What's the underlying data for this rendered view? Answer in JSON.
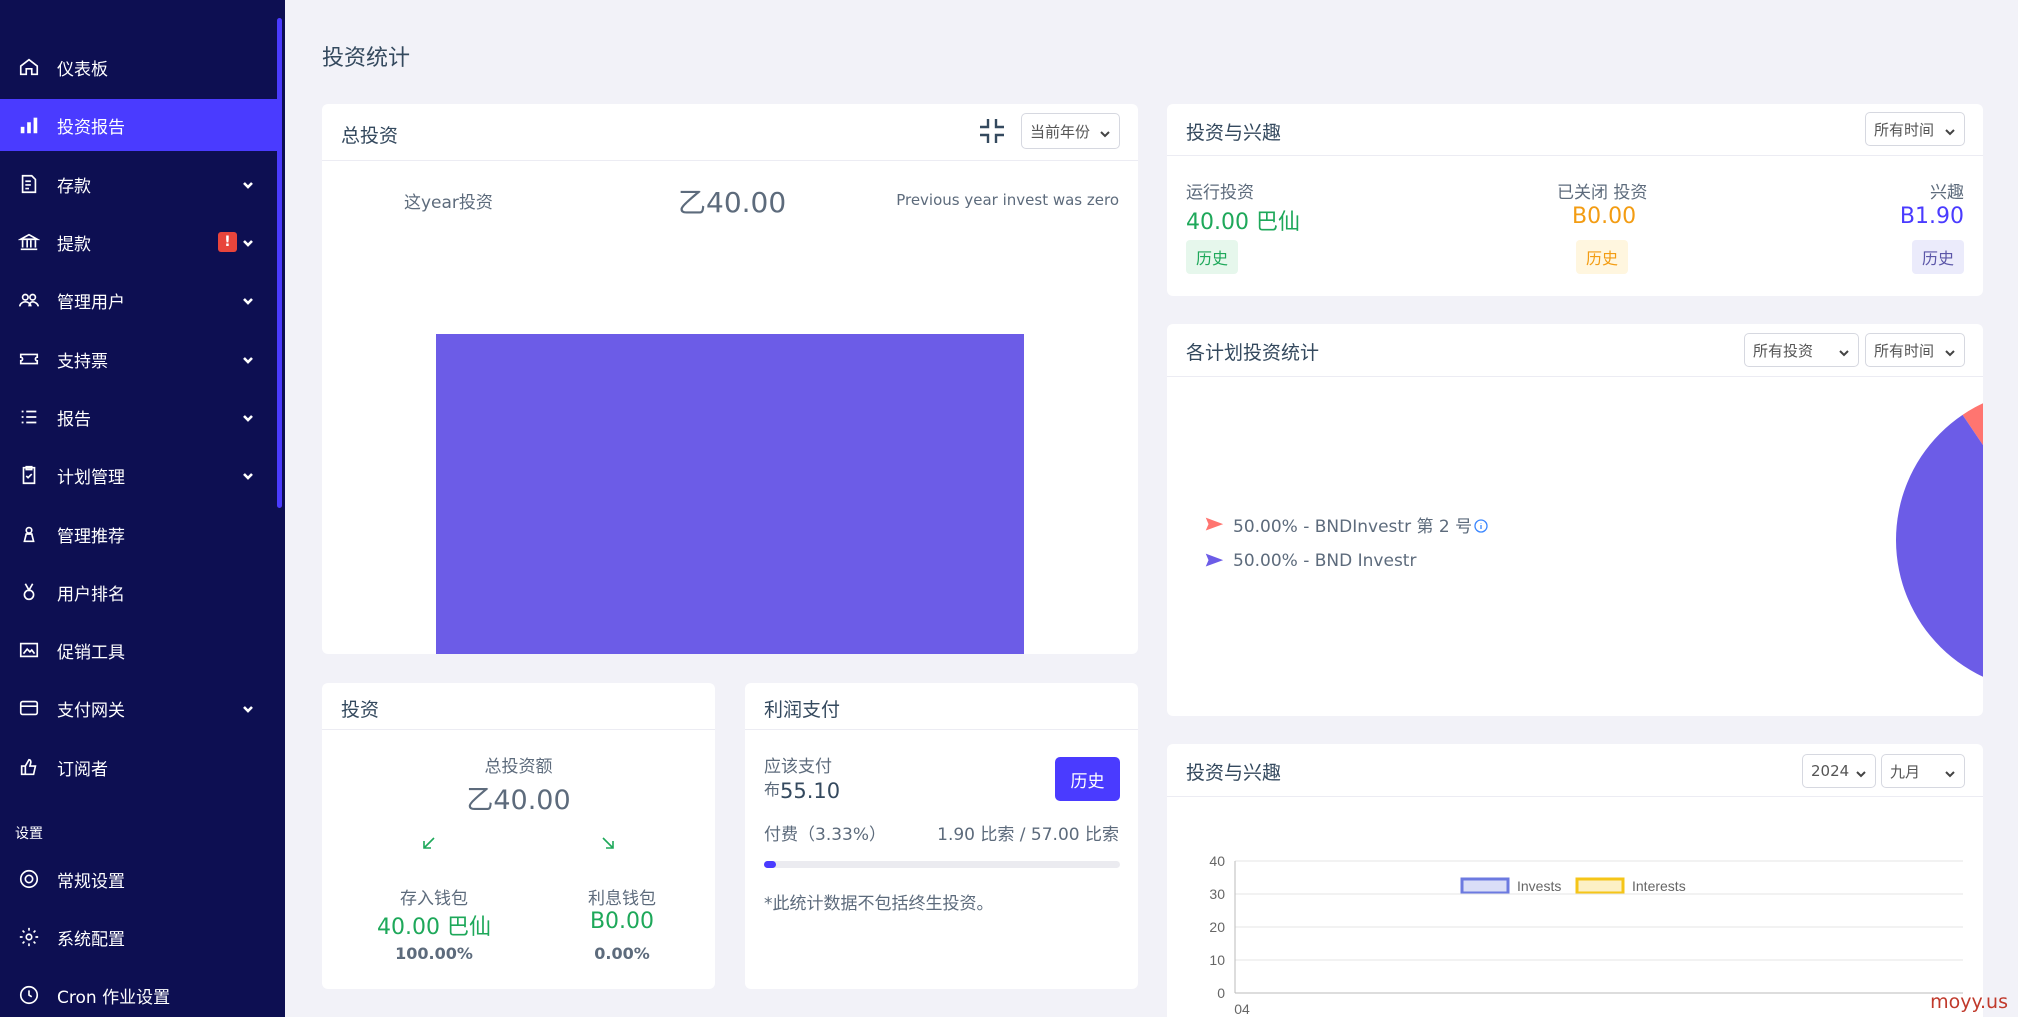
{
  "sidebar": {
    "items": [
      {
        "label": "仪表板",
        "icon": "home-icon"
      },
      {
        "label": "投资报告",
        "icon": "bar-chart-icon"
      },
      {
        "label": "存款",
        "icon": "deposit-icon"
      },
      {
        "label": "提款",
        "icon": "bank-icon",
        "alert": "!"
      },
      {
        "label": "管理用户",
        "icon": "users-icon"
      },
      {
        "label": "支持票",
        "icon": "ticket-icon"
      },
      {
        "label": "报告",
        "icon": "list-icon"
      },
      {
        "label": "计划管理",
        "icon": "clipboard-icon"
      },
      {
        "label": "管理推荐",
        "icon": "referral-icon"
      },
      {
        "label": "用户排名",
        "icon": "medal-icon"
      },
      {
        "label": "促销工具",
        "icon": "image-icon"
      },
      {
        "label": "支付网关",
        "icon": "card-icon"
      },
      {
        "label": "订阅者",
        "icon": "thumbs-up-icon"
      }
    ],
    "settings_title": "设置",
    "settings_items": [
      {
        "label": "常规设置",
        "icon": "life-ring-icon"
      },
      {
        "label": "系统配置",
        "icon": "gear-icon"
      },
      {
        "label": "Cron 作业设置",
        "icon": "clock-icon"
      }
    ]
  },
  "page_title": "投资统计",
  "total_invest": {
    "title": "总投资",
    "select": "当前年份",
    "this_year_label": "这year投资",
    "amount": "乙40.00",
    "prev_note": "Previous year invest was zero"
  },
  "invest_card": {
    "title": "投资",
    "total_label": "总投资额",
    "total_value": "乙40.00",
    "deposit_label": "存入钱包",
    "deposit_value": "40.00 巴仙",
    "deposit_pct": "100.00%",
    "interest_label": "利息钱包",
    "interest_value": "B0.00",
    "interest_pct": "0.00%"
  },
  "profit_card": {
    "title": "利润支付",
    "due_label": "应该支付",
    "due_prefix": "布",
    "due_value": "55.10",
    "history_button": "历史",
    "fee_label": "付费（3.33%）",
    "fee_value": "1.90 比索 / 57.00 比索",
    "progress": 0.0333,
    "note": "*此统计数据不包括终生投资。"
  },
  "invest_interest": {
    "title": "投资与兴趣",
    "select": "所有时间",
    "running_label": "运行投资",
    "running_value": "40.00 巴仙",
    "closed_label": "已关闭 投资",
    "closed_value": "B0.00",
    "interest_label": "兴趣",
    "interest_value": "B1.90",
    "history": "历史"
  },
  "plan_stats": {
    "title": "各计划投资统计",
    "select_plan": "所有投资",
    "select_time": "所有时间",
    "legend": [
      {
        "text": "50.00% - BNDInvestr 第 2 号",
        "color": "#ff7570",
        "info": true
      },
      {
        "text": "50.00% - BND Investr",
        "color": "#6c5ce7",
        "info": false
      }
    ]
  },
  "invest_interest_chart": {
    "title": "投资与兴趣",
    "select_year": "2024",
    "select_month": "九月"
  },
  "watermark": "moyy.us",
  "chart_data": [
    {
      "type": "bar",
      "categories": [
        ""
      ],
      "values": [
        40
      ],
      "series": [
        {
          "values": [
            40
          ],
          "color": "#6c5ce7"
        }
      ],
      "ylim": [
        0,
        40
      ]
    },
    {
      "type": "pie",
      "categories": [
        "BNDInvestr 第 2 号",
        "BND Investr"
      ],
      "values": [
        50,
        50
      ],
      "colors": [
        "#ff7570",
        "#6c5ce7"
      ]
    },
    {
      "type": "line",
      "categories": [
        "04"
      ],
      "series": [
        {
          "name": "Invests",
          "values": [],
          "color": "#6c7ae0"
        },
        {
          "name": "Interests",
          "values": [],
          "color": "#f5c518"
        }
      ],
      "yticks": [
        "0",
        "10",
        "20",
        "30",
        "40"
      ],
      "ylim": [
        0,
        40
      ]
    }
  ]
}
